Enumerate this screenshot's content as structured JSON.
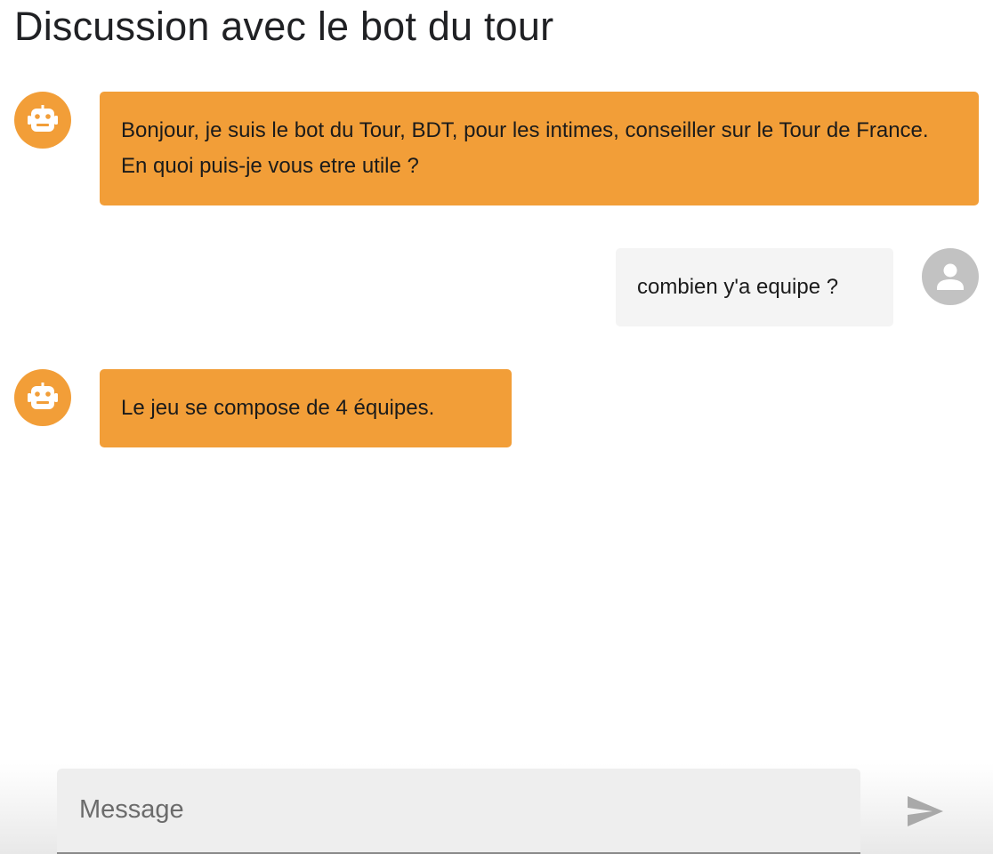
{
  "header": {
    "title": "Discussion avec le bot du tour"
  },
  "messages": [
    {
      "sender": "bot",
      "avatar_icon": "robot-icon",
      "text": "Bonjour, je suis le bot du Tour, BDT, pour les intimes, conseiller sur le Tour de France. En quoi puis-je vous etre utile ?"
    },
    {
      "sender": "user",
      "avatar_icon": "user-icon",
      "text": "combien y'a equipe ?"
    },
    {
      "sender": "bot",
      "avatar_icon": "robot-icon",
      "text": "Le jeu se compose de 4 équipes."
    }
  ],
  "composer": {
    "placeholder": "Message",
    "send_icon": "send-icon"
  },
  "colors": {
    "bot_bubble": "#f29e38",
    "user_bubble": "#f4f4f4",
    "user_avatar": "#c2c2c2",
    "send_icon": "#a9a9a9"
  }
}
